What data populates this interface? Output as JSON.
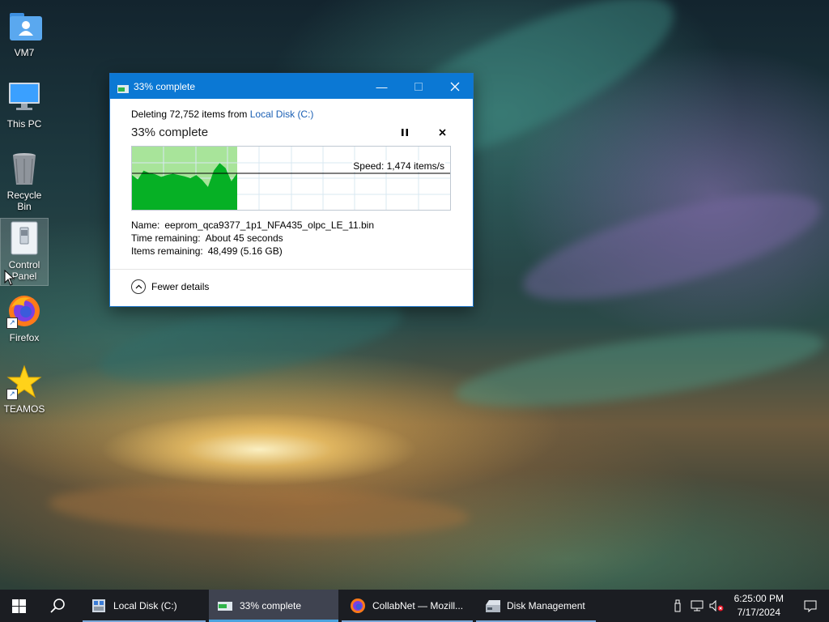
{
  "desktop": {
    "icons": [
      {
        "label": "VM7",
        "icon": "user-folder-icon"
      },
      {
        "label": "This PC",
        "icon": "monitor-icon"
      },
      {
        "label": "Recycle Bin",
        "icon": "recycle-bin-icon"
      },
      {
        "label": "Control Panel",
        "icon": "control-panel-icon"
      },
      {
        "label": "Firefox",
        "icon": "firefox-icon"
      },
      {
        "label": "TEAMOS",
        "icon": "star-icon"
      }
    ]
  },
  "dialog": {
    "title": "33% complete",
    "deleting_prefix": "Deleting 72,752 items from ",
    "source_link": "Local Disk (C:)",
    "percent_text": "33% complete",
    "progress_fraction": 0.33,
    "speed_label": "Speed: 1,474 items/s",
    "name_label": "Name:",
    "name_value": "eeprom_qca9377_1p1_NFA435_olpc_LE_11.bin",
    "time_label": "Time remaining:",
    "time_value": "About 45 seconds",
    "items_label": "Items remaining:",
    "items_value": "48,499 (5.16 GB)",
    "fewer_details": "Fewer details",
    "colors": {
      "titlebar": "#0b78d4",
      "graph_fill": "#06b025",
      "graph_done_bg": "#a8e49a"
    }
  },
  "taskbar": {
    "items": [
      {
        "label": "Local Disk (C:)",
        "icon": "file-explorer-icon"
      },
      {
        "label": "33% complete",
        "icon": "copy-progress-icon",
        "active": true
      },
      {
        "label": "CollabNet — Mozill...",
        "icon": "firefox-icon"
      },
      {
        "label": "Disk Management",
        "icon": "disk-management-icon"
      }
    ],
    "clock_time": "6:25:00 PM",
    "clock_date": "7/17/2024"
  }
}
